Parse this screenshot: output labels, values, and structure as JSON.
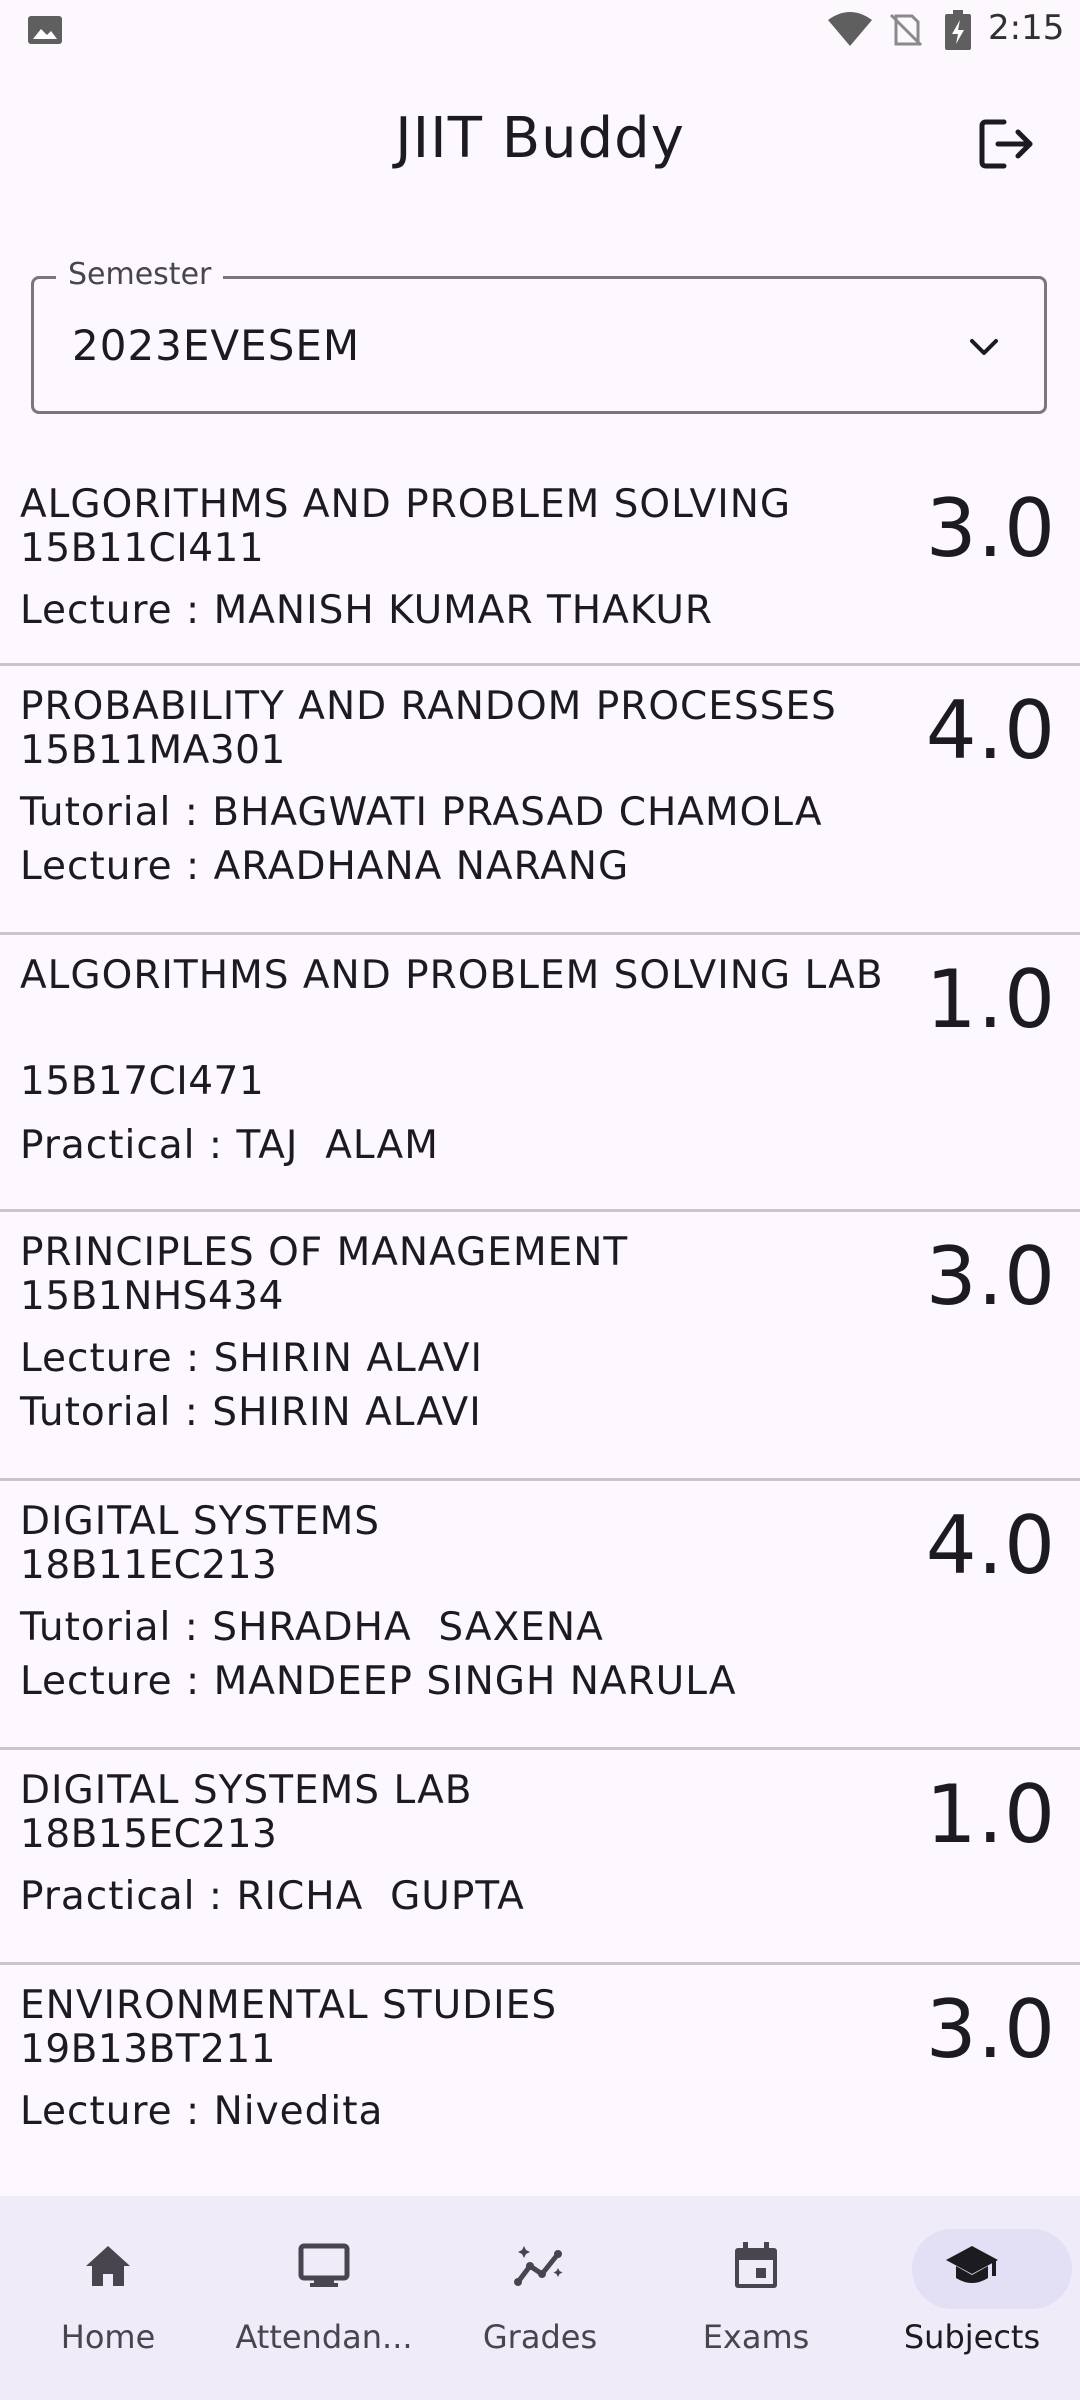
{
  "status_bar": {
    "time": "2:15",
    "icons": [
      "image-icon",
      "wifi-icon",
      "no-sim-icon",
      "battery-icon"
    ]
  },
  "app_bar": {
    "title": "JIIT Buddy",
    "logout_icon": "logout-icon"
  },
  "semester": {
    "label": "Semester",
    "value": "2023EVESEM"
  },
  "subjects": [
    {
      "name": "ALGORITHMS AND PROBLEM SOLVING",
      "code": "15B11CI411",
      "faculty": [
        "Lecture : MANISH KUMAR THAKUR"
      ],
      "credits": "3.0"
    },
    {
      "name": "PROBABILITY AND RANDOM PROCESSES",
      "code": "15B11MA301",
      "faculty": [
        "Tutorial : BHAGWATI PRASAD CHAMOLA",
        "Lecture : ARADHANA NARANG"
      ],
      "credits": "4.0"
    },
    {
      "name": "ALGORITHMS AND PROBLEM SOLVING LAB",
      "code": "15B17CI471",
      "faculty": [
        "Practical : TAJ  ALAM"
      ],
      "credits": "1.0"
    },
    {
      "name": "PRINCIPLES OF MANAGEMENT",
      "code": "15B1NHS434",
      "faculty": [
        "Lecture : SHIRIN ALAVI",
        "Tutorial : SHIRIN ALAVI"
      ],
      "credits": "3.0"
    },
    {
      "name": "DIGITAL SYSTEMS",
      "code": "18B11EC213",
      "faculty": [
        "Tutorial : SHRADHA  SAXENA",
        "Lecture : MANDEEP SINGH NARULA"
      ],
      "credits": "4.0"
    },
    {
      "name": "DIGITAL SYSTEMS LAB",
      "code": "18B15EC213",
      "faculty": [
        "Practical : RICHA  GUPTA"
      ],
      "credits": "1.0"
    },
    {
      "name": "ENVIRONMENTAL STUDIES",
      "code": "19B13BT211",
      "faculty": [
        "Lecture : Nivedita"
      ],
      "credits": "3.0"
    }
  ],
  "bottom_nav": {
    "items": [
      {
        "label": "Home",
        "icon": "home-icon"
      },
      {
        "label": "Attendan...",
        "icon": "monitor-icon"
      },
      {
        "label": "Grades",
        "icon": "grades-chart-icon"
      },
      {
        "label": "Exams",
        "icon": "calendar-icon"
      },
      {
        "label": "Subjects",
        "icon": "graduation-cap-icon",
        "active": true
      }
    ],
    "active_color": "#e3dff5"
  }
}
